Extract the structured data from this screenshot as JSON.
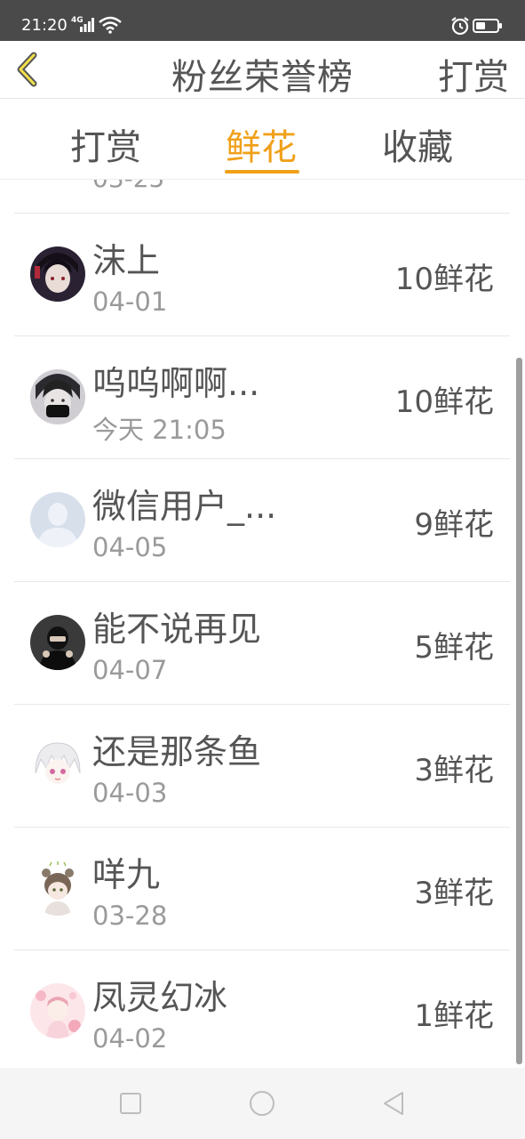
{
  "status": {
    "time": "21:20",
    "network": "4G"
  },
  "header": {
    "title": "粉丝荣誉榜",
    "action": "打赏"
  },
  "tabs": [
    {
      "label": "打赏"
    },
    {
      "label": "鲜花"
    },
    {
      "label": "收藏"
    }
  ],
  "active_tab": 1,
  "partial_row": {
    "date": "03-25"
  },
  "rows": [
    {
      "name": "沫上",
      "date": "04-01",
      "count": "10鲜花"
    },
    {
      "name": "呜呜啊啊...",
      "date": "今天 21:05",
      "count": "10鲜花"
    },
    {
      "name": "微信用户_...",
      "date": "04-05",
      "count": "9鲜花"
    },
    {
      "name": "能不说再见",
      "date": "04-07",
      "count": "5鲜花"
    },
    {
      "name": "还是那条鱼",
      "date": "04-03",
      "count": "3鲜花"
    },
    {
      "name": "咩九",
      "date": "03-28",
      "count": "3鲜花"
    },
    {
      "name": "凤灵幻冰",
      "date": "04-02",
      "count": "1鲜花"
    }
  ],
  "colors": {
    "accent": "#f0a019",
    "status_bar": "#4a4a4a",
    "text": "#555555",
    "muted": "#9a9a9a"
  }
}
